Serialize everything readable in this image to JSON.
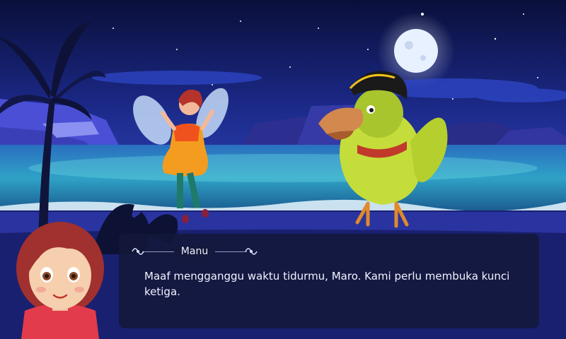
{
  "dialog": {
    "speaker": "Manu",
    "text": "Maaf mengganggu waktu tidurmu, Maro. Kami perlu membuka kunci ketiga."
  },
  "characters": {
    "portrait": "girl-portrait",
    "fairy": "fairy-character",
    "parrot": "pirate-parrot-character"
  },
  "colors": {
    "sky": "#1b2570",
    "sea": "#1f6fa8",
    "dialog_bg": "#14183a",
    "parrot_green": "#c5dd3a",
    "fairy_dress": "#f39c1f"
  }
}
